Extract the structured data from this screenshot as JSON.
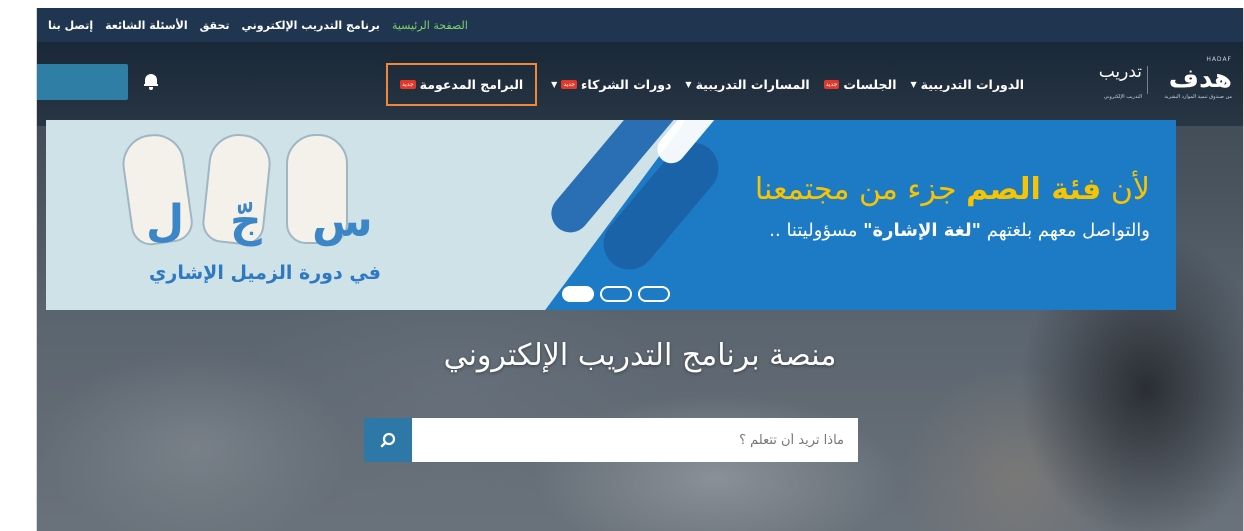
{
  "topbar": {
    "links": [
      "الصفحة الرئيسية",
      "برنامج التدريب الإلكتروني",
      "تحقق",
      "الأسئلة الشائعة",
      "إتصل بنا"
    ]
  },
  "logo": {
    "hadaf_latin": "HADAF",
    "hadaf": "هدف",
    "hadaf_sub": "من صندوق تنمية الموارد البشرية",
    "tadreeb": "تدريب",
    "tadreeb_sub": "التدريب الإلكتروني"
  },
  "nav": {
    "courses": "الدورات التدريبية",
    "sessions": "الجلسات",
    "tracks": "المسارات التدريبية",
    "partners": "دورات الشركاء",
    "sponsored": "البرامج المدعومة",
    "new_badge": "جديد"
  },
  "banner": {
    "title_prefix": "لأن",
    "title_bold": "فئة الصم",
    "title_suffix": "جزء من مجتمعنا",
    "sub_prefix": "والتواصل معهم بلغتهم",
    "sub_bold": "\"لغة الإشارة\"",
    "sub_suffix": "مسؤوليتنا ..",
    "caption": "في دورة الزميل الإشاري",
    "glyph_1": "ل",
    "glyph_2": "جّ",
    "glyph_3": "س"
  },
  "hero": {
    "title": "منصة برنامج التدريب الإلكتروني"
  },
  "search": {
    "placeholder": "ماذا تريد أن تتعلم ؟"
  },
  "colors": {
    "topbar": "#1f3550",
    "active_link": "#7fd16b",
    "banner_blue": "#1d7bc6",
    "banner_yellow": "#f6c400",
    "highlight_border": "#f0873a",
    "button_blue": "#2e78a8"
  },
  "icons": [
    "bell-icon",
    "search-icon",
    "caret-down-icon"
  ]
}
